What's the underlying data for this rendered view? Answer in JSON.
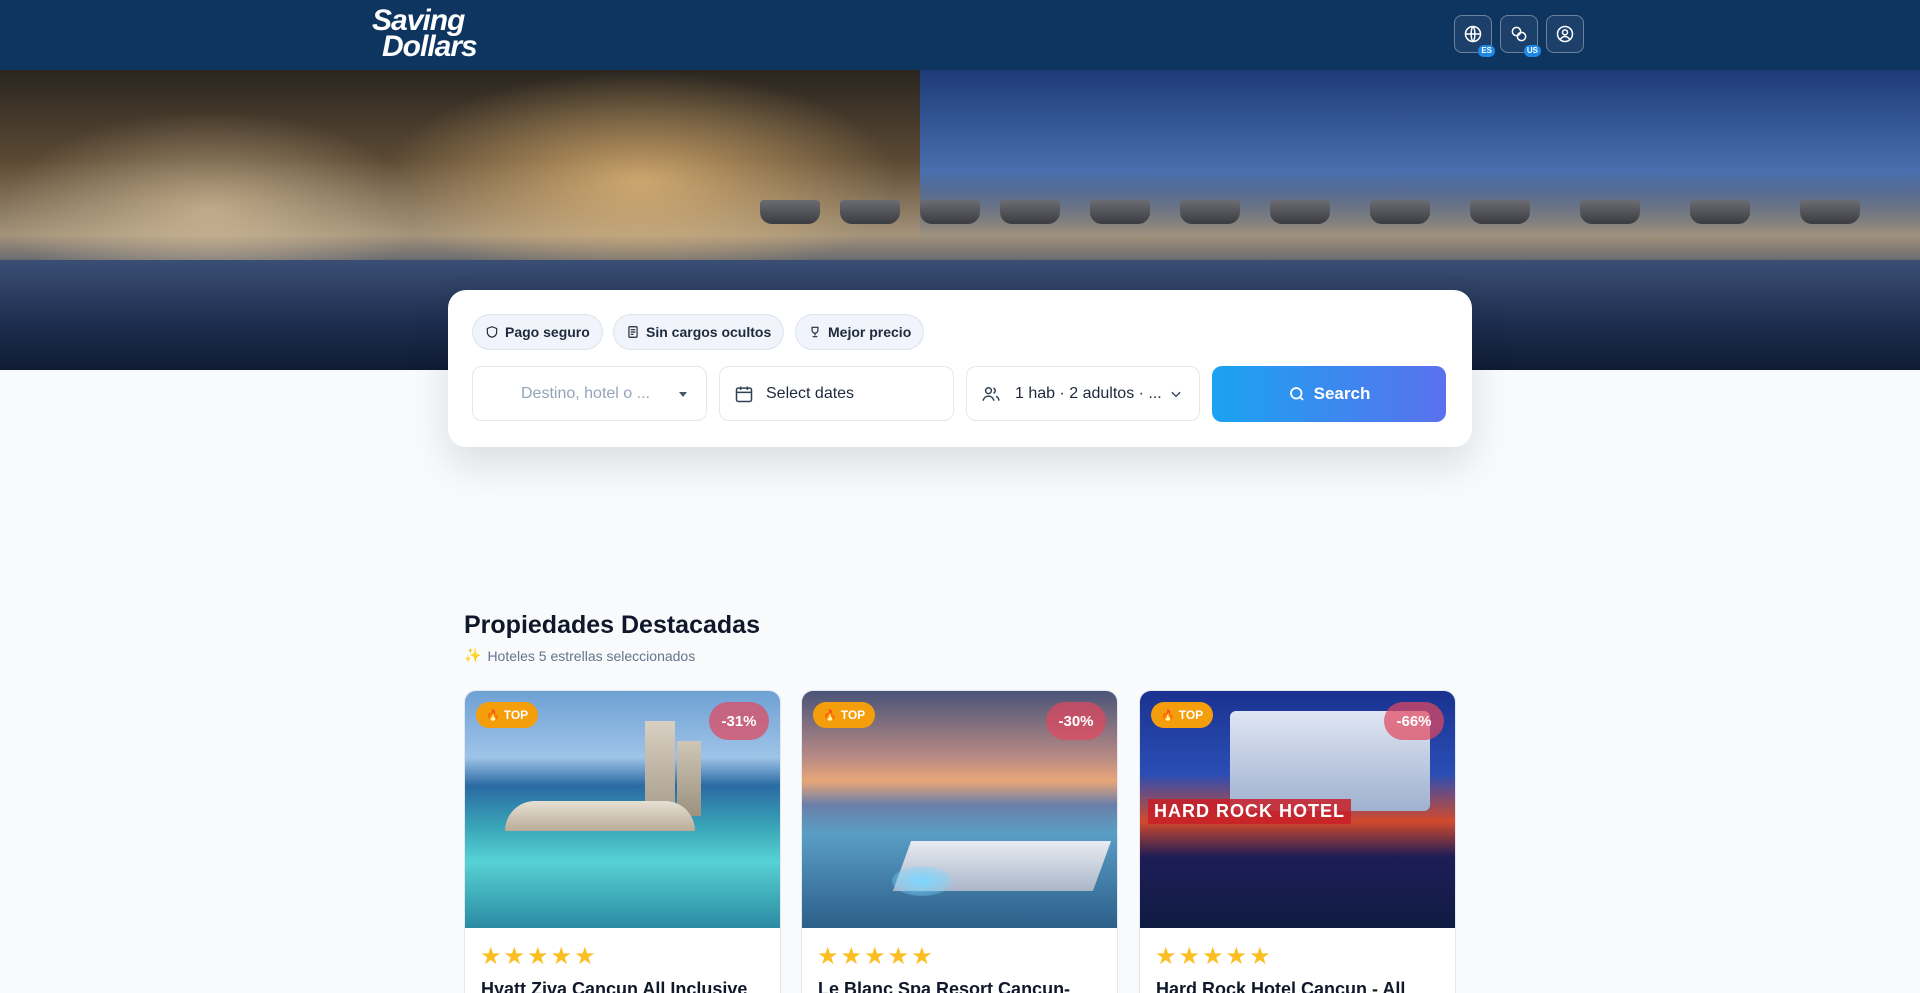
{
  "header": {
    "logo_line1": "Saving",
    "logo_line2": "Dollars",
    "language_badge": "ES",
    "currency_badge": "US",
    "icons": [
      "globe-icon",
      "coins-icon",
      "user-icon"
    ]
  },
  "search": {
    "chips": [
      {
        "label": "Pago seguro",
        "icon": "shield-icon"
      },
      {
        "label": "Sin cargos ocultos",
        "icon": "receipt-icon"
      },
      {
        "label": "Mejor precio",
        "icon": "trophy-icon"
      }
    ],
    "destination_placeholder": "Destino, hotel o ...",
    "dates_label": "Select dates",
    "guests_label": "1 hab · 2 adultos · ...",
    "search_label": "Search"
  },
  "featured": {
    "title": "Propiedades Destacadas",
    "subtitle": "Hoteles 5 estrellas seleccionados",
    "cards": [
      {
        "badge": "TOP",
        "discount": "-31%",
        "stars": 5,
        "title": "Hyatt Ziva Cancun All Inclusive"
      },
      {
        "badge": "TOP",
        "discount": "-30%",
        "stars": 5,
        "title": "Le Blanc Spa Resort Cancun-"
      },
      {
        "badge": "TOP",
        "discount": "-66%",
        "stars": 5,
        "title": "Hard Rock Hotel Cancun - All",
        "sign_text": "HARD ROCK HOTEL"
      }
    ]
  },
  "colors": {
    "header_bg": "#0e3560",
    "search_button_start": "#1aa3f0",
    "search_button_end": "#5a71ee",
    "top_badge": "#f59e0b",
    "discount_badge": "#e14860",
    "star": "#fbbf24"
  }
}
